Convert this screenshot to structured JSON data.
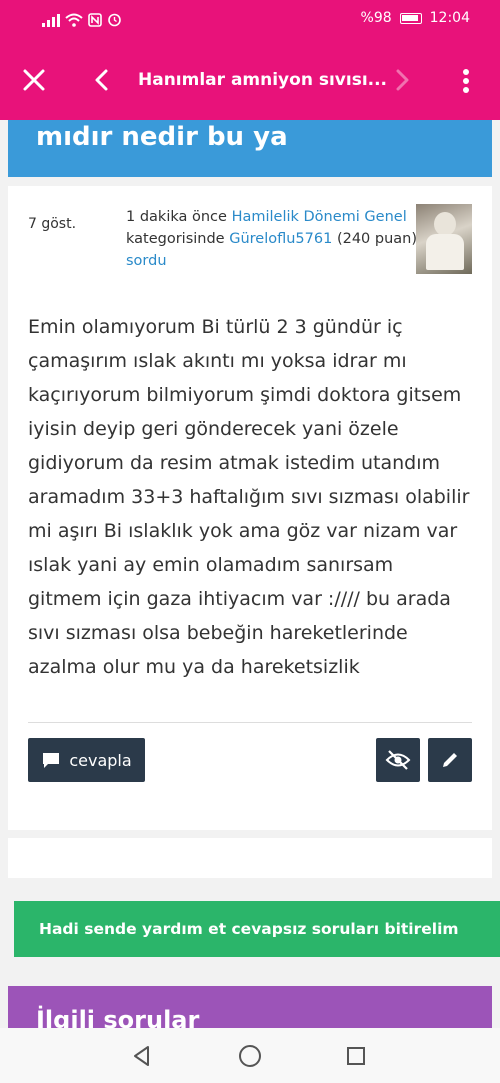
{
  "status_bar": {
    "battery": "%98",
    "time": "12:04",
    "icons": [
      "signal-icon",
      "wifi-icon",
      "nfc-icon",
      "alarm-icon",
      "battery-icon"
    ]
  },
  "app_bar": {
    "title": "Hanımlar amniyon sıvısı...",
    "icons": [
      "close-icon",
      "back-icon",
      "forward-icon",
      "more-icon"
    ]
  },
  "question": {
    "title_partial": "mıdır nedir bu ya",
    "views": "7 göst.",
    "meta_time": "1 dakika önce",
    "category": "Hamilelik Dönemi Genel",
    "category_suffix": "kategorisinde",
    "author": "Güreloflu5761",
    "points": "(240 puan)",
    "action": "sordu",
    "body": "Emin olamıyorum Bi türlü 2 3 gündür iç çamaşırım ıslak akıntı mı yoksa idrar mı kaçırıyorum bilmiyorum şimdi doktora gitsem iyisin deyip geri gönderecek yani özele gidiyorum da resim atmak istedim utandım aramadım 33+3 haftalığım sıvı sızması olabilir mi aşırı Bi ıslaklık yok ama göz var nizam var ıslak yani ay emin olamadım sanırsam gitmem için gaza ihtiyacım var :////  bu arada sıvı sızması olsa bebeğin hareketlerinde azalma olur mu ya da hareketsizlik"
  },
  "actions": {
    "reply_label": "cevapla"
  },
  "promo": {
    "label": "Hadi sende yardım et cevapsız soruları bitirelim"
  },
  "related": {
    "title": "İlgili sorular"
  },
  "colors": {
    "brand_pink": "#e8127a",
    "title_blue": "#3a9ad9",
    "link_blue": "#2a8ac9",
    "button_dark": "#2b3a4a",
    "promo_green": "#2bb56a",
    "related_purple": "#9c54b8"
  }
}
